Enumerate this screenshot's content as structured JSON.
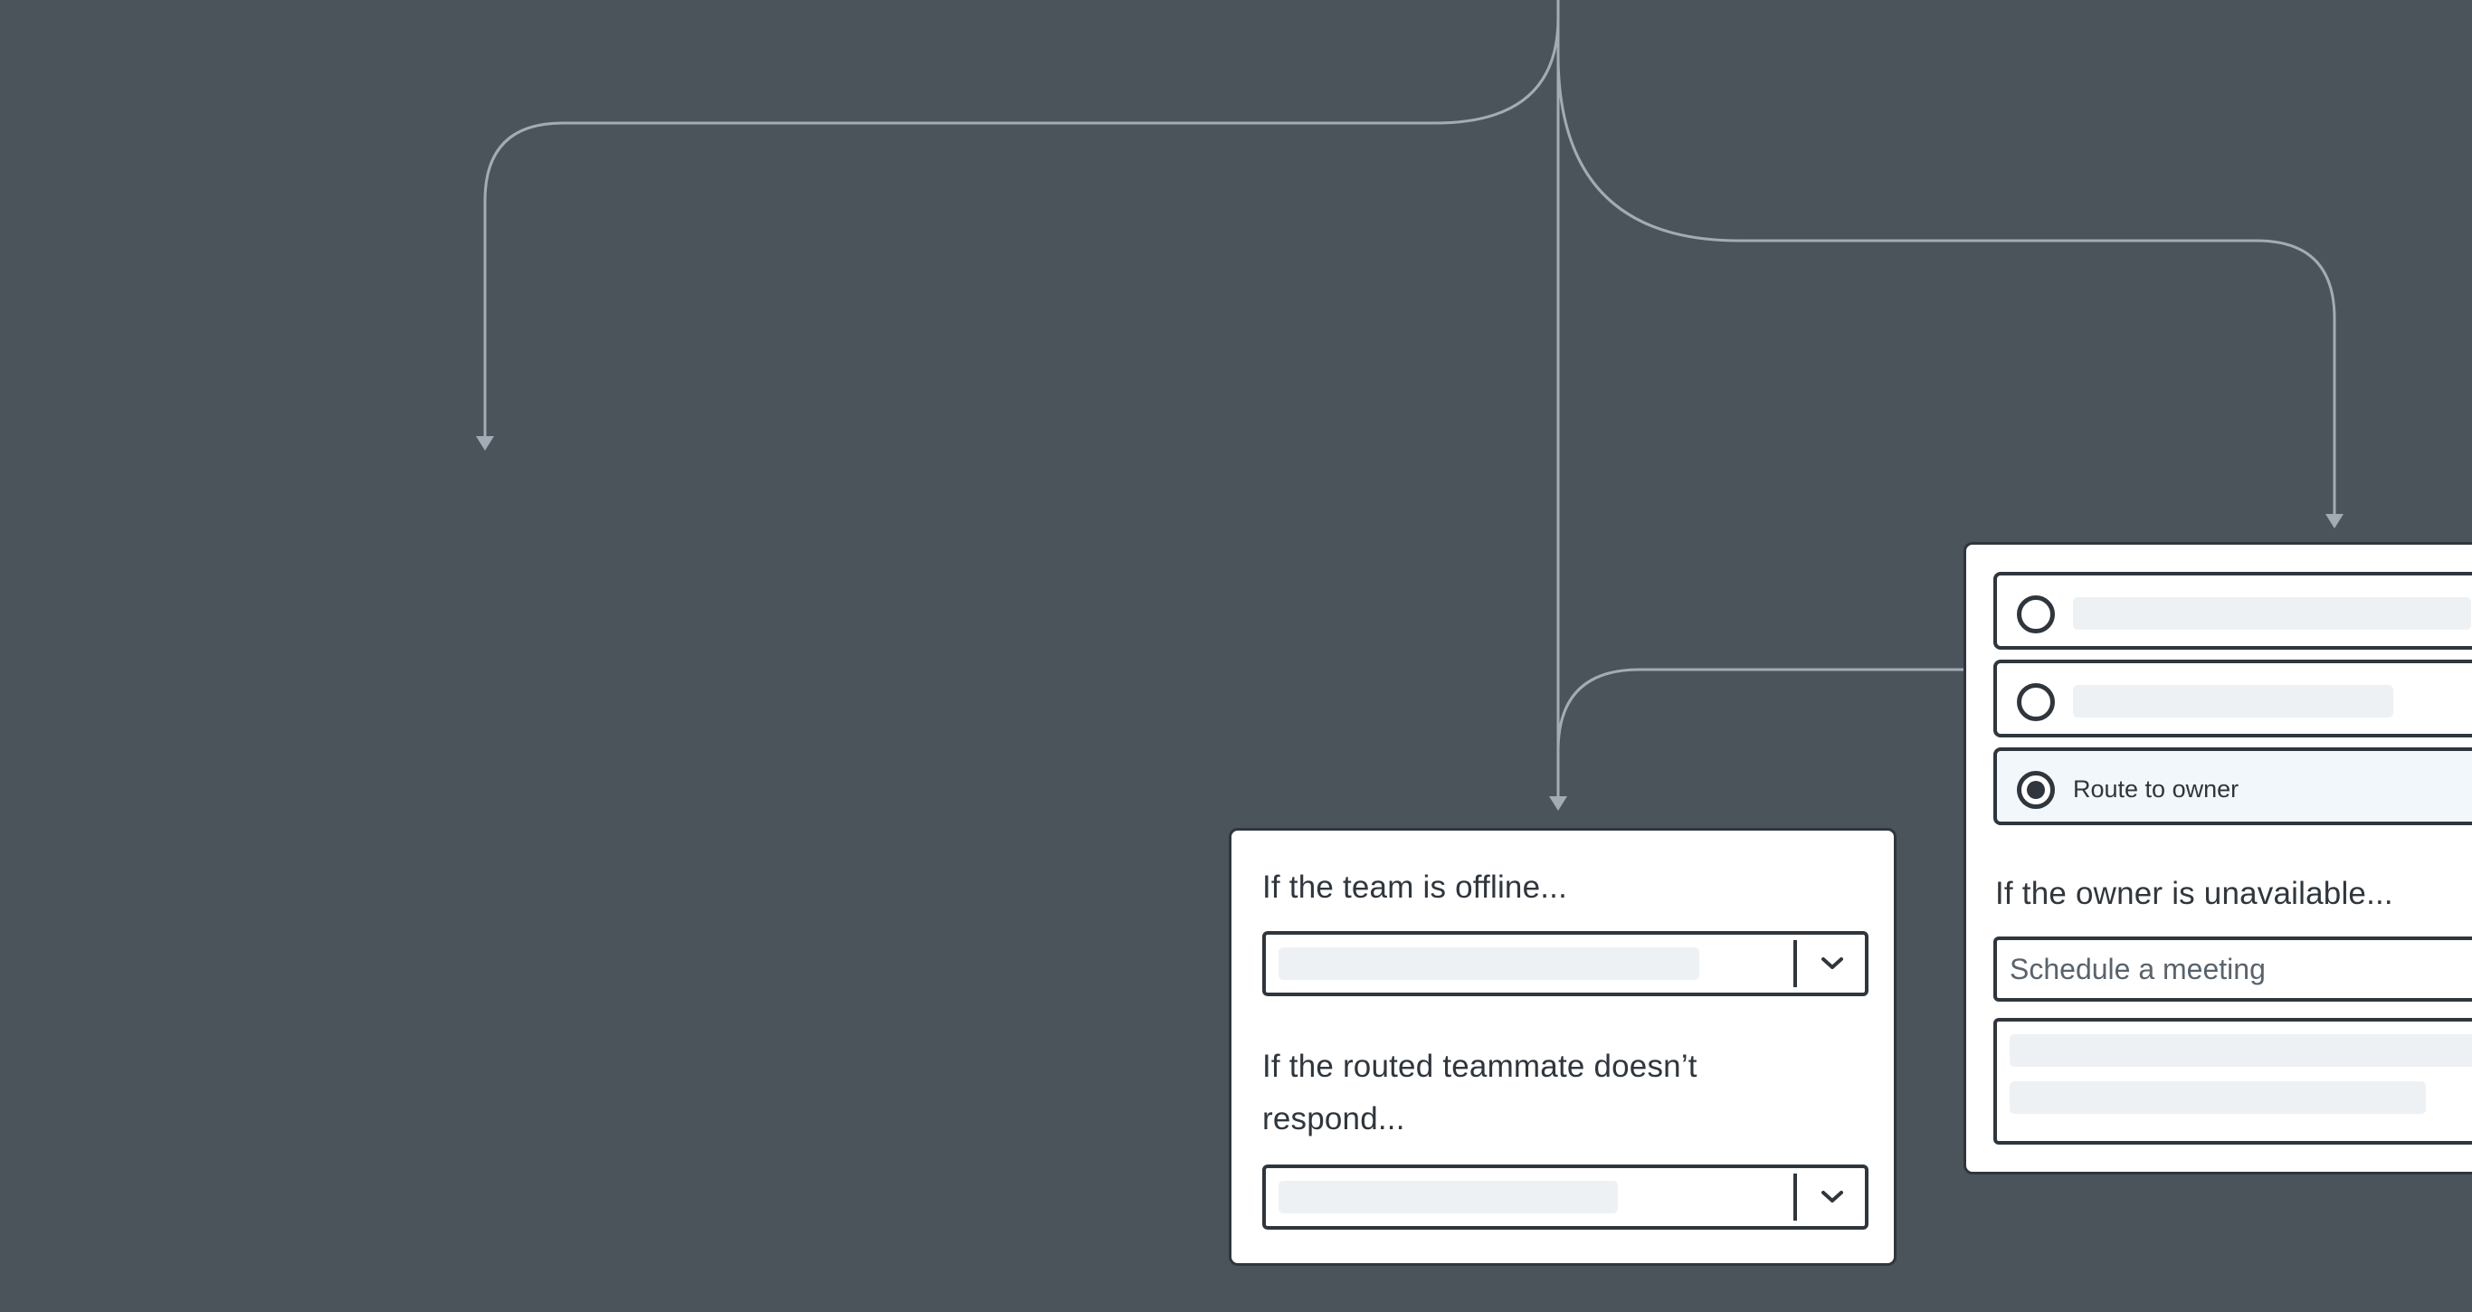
{
  "colors": {
    "background": "#4b535b",
    "connector": "#a3acb4",
    "card_border": "#2f363d",
    "card_background": "#ffffff",
    "placeholder": "#eef1f4",
    "selected_option_background": "#f2f7fb"
  },
  "offline_card": {
    "team_offline_question": "If the team is offline...",
    "teammate_no_response_question": "If the routed teammate doesn’t respond...",
    "dropdown_icon": "chevron-down-icon"
  },
  "owner_card": {
    "routing_options": [
      {
        "label": "",
        "selected": false
      },
      {
        "label": "",
        "selected": false
      },
      {
        "label": "Route to owner",
        "selected": true
      }
    ],
    "owner_unavailable_question": "If the owner is unavailable...",
    "fallback_action_value": "Schedule a meeting"
  }
}
